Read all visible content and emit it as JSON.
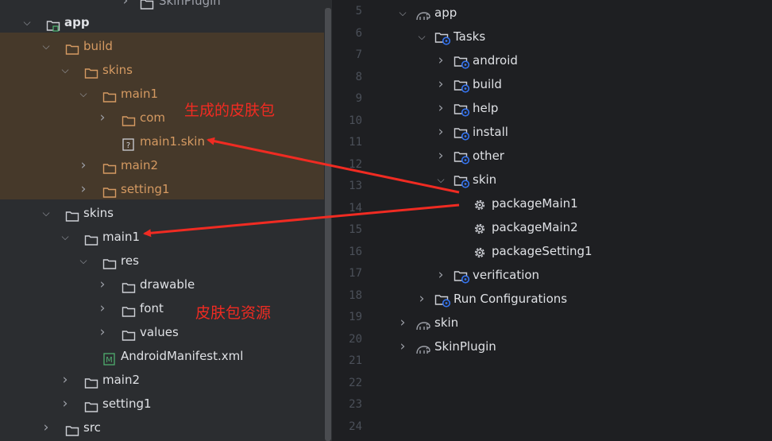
{
  "left_tree": [
    {
      "name": "SkinPlugin",
      "cut": true
    },
    {
      "name": "app",
      "bold": true
    },
    {
      "name": "build"
    },
    {
      "name": "skins"
    },
    {
      "name": "main1"
    },
    {
      "name": "com"
    },
    {
      "name": "main1.skin"
    },
    {
      "name": "main2"
    },
    {
      "name": "setting1"
    },
    {
      "name": "skins"
    },
    {
      "name": "main1"
    },
    {
      "name": "res"
    },
    {
      "name": "drawable"
    },
    {
      "name": "font"
    },
    {
      "name": "values"
    },
    {
      "name": "AndroidManifest.xml"
    },
    {
      "name": "main2"
    },
    {
      "name": "setting1"
    },
    {
      "name": "src"
    }
  ],
  "line_numbers": [
    "5",
    "6",
    "7",
    "8",
    "9",
    "10",
    "11",
    "12",
    "13",
    "14",
    "15",
    "16",
    "17",
    "18",
    "19",
    "20",
    "21",
    "22",
    "23",
    "24"
  ],
  "gradle_tree": [
    {
      "name": "app"
    },
    {
      "name": "Tasks"
    },
    {
      "name": "android"
    },
    {
      "name": "build"
    },
    {
      "name": "help"
    },
    {
      "name": "install"
    },
    {
      "name": "other"
    },
    {
      "name": "skin"
    },
    {
      "name": "packageMain1"
    },
    {
      "name": "packageMain2"
    },
    {
      "name": "packageSetting1"
    },
    {
      "name": "verification"
    },
    {
      "name": "Run Configurations"
    },
    {
      "name": "skin"
    },
    {
      "name": "SkinPlugin"
    }
  ],
  "annotations": {
    "skin_package": "生成的皮肤包",
    "skin_resources": "皮肤包资源"
  },
  "colors": {
    "annotation": "#f02b22",
    "highlight_bg": "#46392a",
    "build_folder_text": "#d59a62",
    "folder_icon": "#ced0d6",
    "gradle_badge": "#3574f0"
  }
}
